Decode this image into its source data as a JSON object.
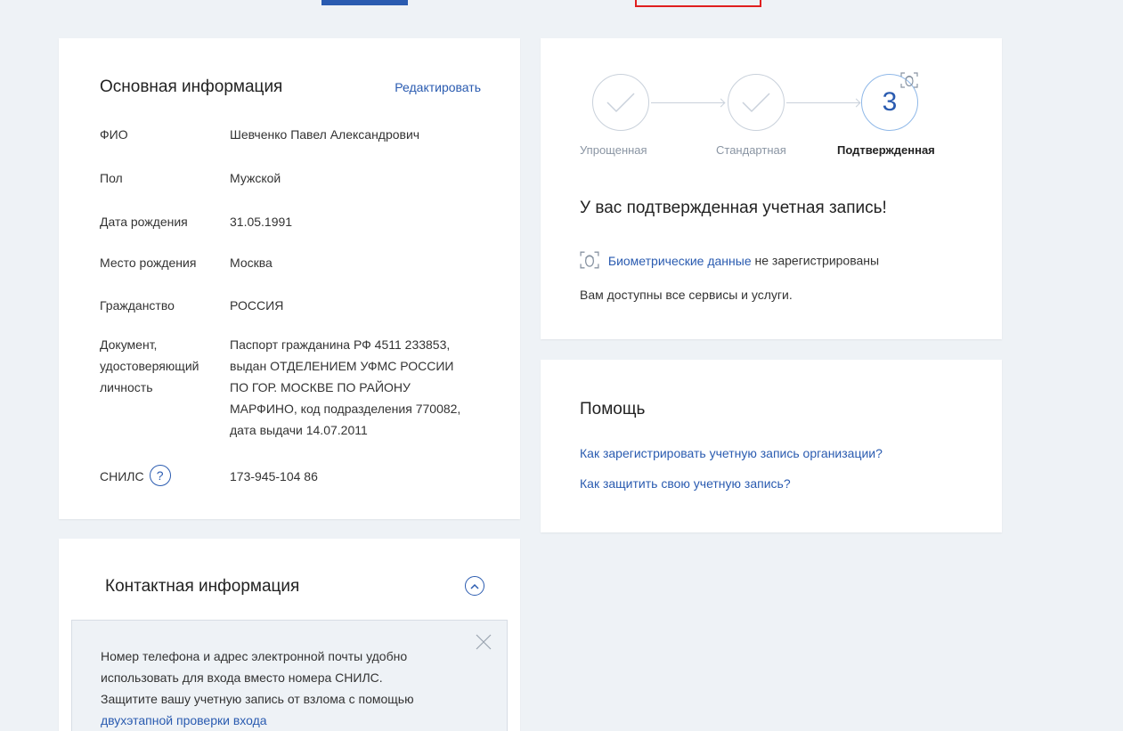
{
  "basic_info": {
    "title": "Основная информация",
    "edit_label": "Редактировать",
    "rows": [
      {
        "label": "ФИО",
        "value": "Шевченко Павел Александрович"
      },
      {
        "label": "Пол",
        "value": "Мужской"
      },
      {
        "label": "Дата рождения",
        "value": "31.05.1991"
      },
      {
        "label": "Место рождения",
        "value": "Москва"
      },
      {
        "label": "Гражданство",
        "value": "РОССИЯ"
      }
    ],
    "document": {
      "label_lines": [
        "Документ,",
        "удостоверяющий",
        "личность"
      ],
      "value_lines": [
        "Паспорт гражданина РФ 4511 233853,",
        "выдан ОТДЕЛЕНИЕМ УФМС РОССИИ",
        "ПО ГОР. МОСКВЕ ПО РАЙОНУ",
        "МАРФИНО, код подразделения 770082,",
        "дата выдачи 14.07.2011"
      ]
    },
    "snils": {
      "label": "СНИЛС",
      "help_icon": "?",
      "value": "173-945-104 86"
    }
  },
  "account_status": {
    "steps": [
      {
        "label": "Упрощенная",
        "state": "done"
      },
      {
        "label": "Стандартная",
        "state": "done"
      },
      {
        "label": "Подтвержденная",
        "state": "current",
        "number": "3"
      }
    ],
    "heading": "У вас подтвержденная учетная запись!",
    "biometric_link": "Биометрические данные",
    "biometric_status": "не зарегистрированы",
    "available_text": "Вам доступны все сервисы и услуги."
  },
  "help": {
    "title": "Помощь",
    "links": [
      "Как зарегистрировать учетную запись организации?",
      "Как защитить свою учетную запись?"
    ]
  },
  "contact_info": {
    "title": "Контактная информация",
    "notice_lines": [
      "Номер телефона и адрес электронной почты удобно",
      "использовать для входа вместо номера СНИЛС.",
      "Защитите вашу учетную запись от взлома с помощью"
    ],
    "notice_link": "двухэтапной проверки входа"
  },
  "colors": {
    "accent": "#2a5bb0",
    "background": "#eef2f6",
    "highlight_box": "#e01f1f"
  }
}
